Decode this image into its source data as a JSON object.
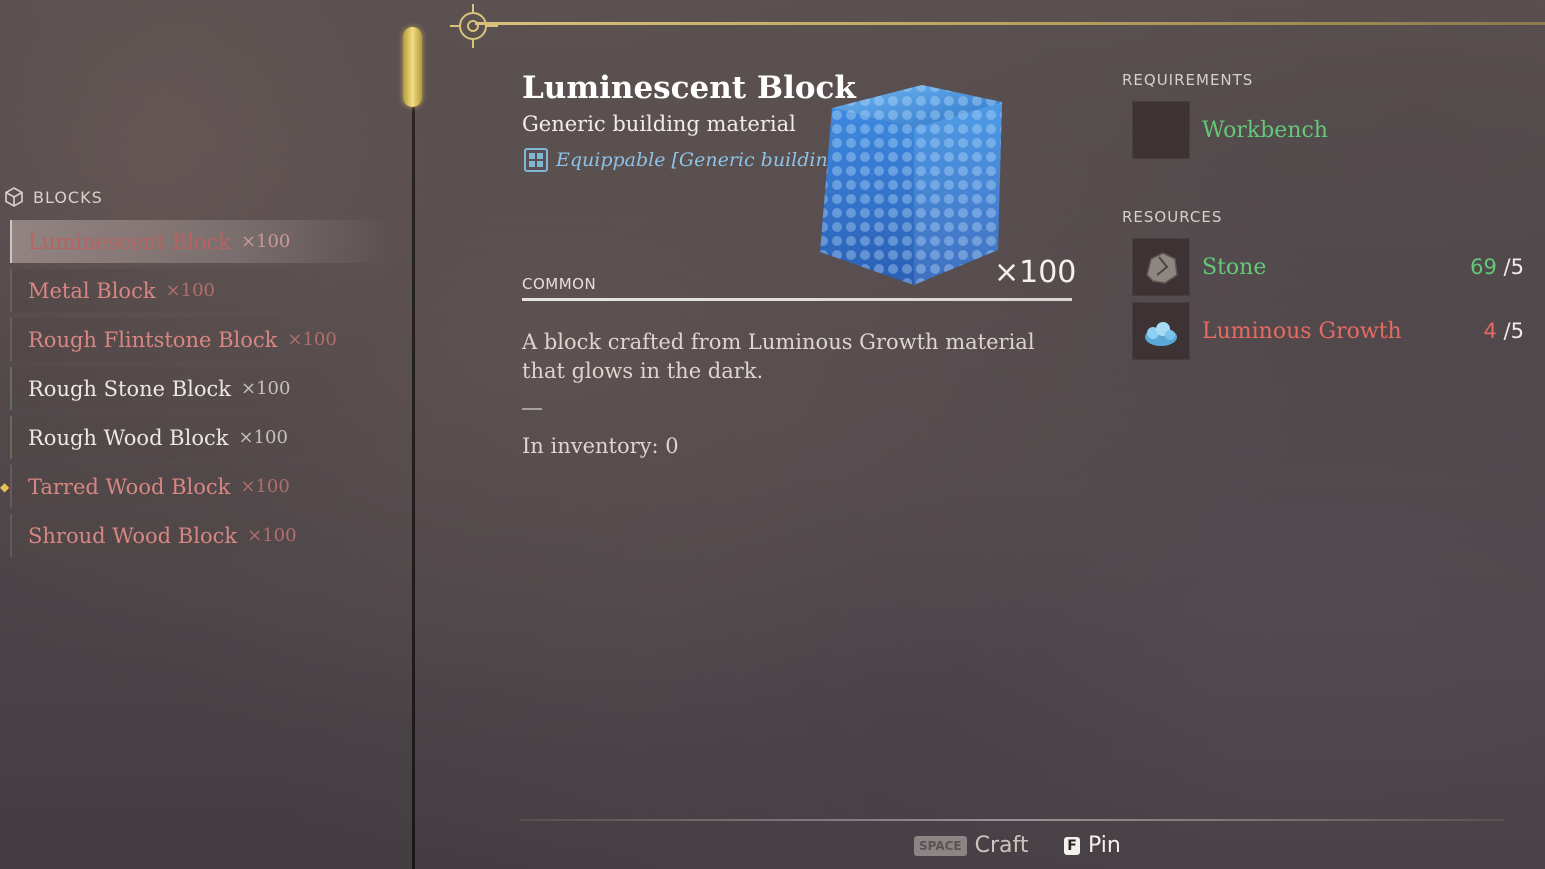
{
  "category": {
    "label": "BLOCKS",
    "icon": "cube-icon"
  },
  "list": [
    {
      "name": "Luminescent Block",
      "qty": "×100",
      "state": "selected"
    },
    {
      "name": "Metal Block",
      "qty": "×100",
      "state": "red"
    },
    {
      "name": "Rough Flintstone Block",
      "qty": "×100",
      "state": "red"
    },
    {
      "name": "Rough Stone Block",
      "qty": "×100",
      "state": "ok"
    },
    {
      "name": "Rough Wood Block",
      "qty": "×100",
      "state": "ok"
    },
    {
      "name": "Tarred Wood Block",
      "qty": "×100",
      "state": "red"
    },
    {
      "name": "Shroud Wood Block",
      "qty": "×100",
      "state": "red"
    }
  ],
  "item": {
    "title": "Luminescent Block",
    "subtitle": "Generic building material",
    "equippable": "Equippable [Generic building material]",
    "rarity": "COMMON",
    "quantity": "×100",
    "description": "A block crafted from Luminous Growth material that glows in the dark.",
    "inventory": "In inventory: 0",
    "image": "luminescent-block-icon"
  },
  "requirements": {
    "label": "REQUIREMENTS",
    "items": [
      {
        "name": "Workbench",
        "color": "#63c978"
      }
    ]
  },
  "resources": {
    "label": "RESOURCES",
    "items": [
      {
        "name": "Stone",
        "have": "69",
        "sep": "/",
        "need": "5",
        "status": "ok",
        "icon": "stone-icon"
      },
      {
        "name": "Luminous Growth",
        "have": "4",
        "sep": "/",
        "need": "5",
        "status": "missing",
        "icon": "luminous-growth-icon"
      }
    ]
  },
  "controls": {
    "craft_key": "SPACE",
    "craft_label": "Craft",
    "pin_key": "F",
    "pin_label": "Pin"
  },
  "colors": {
    "accent_gold": "#d9c27a",
    "available": "#63c978",
    "missing": "#e66a62",
    "equip_blue": "#8dc3e6"
  }
}
